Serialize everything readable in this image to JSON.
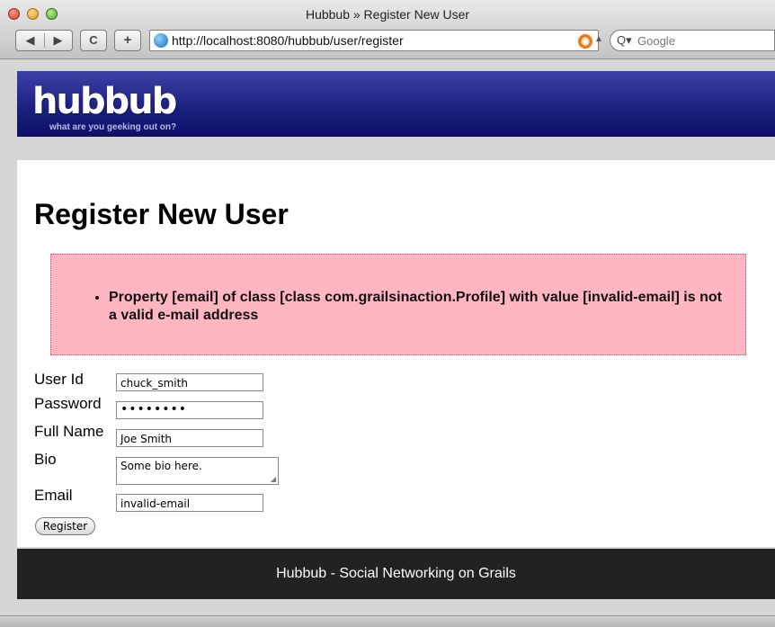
{
  "browser": {
    "window_title": "Hubbub » Register New User",
    "url": "http://localhost:8080/hubbub/user/register",
    "search_placeholder": "Google",
    "back_glyph": "◀",
    "forward_glyph": "▶",
    "reload_glyph": "C",
    "add_glyph": "+"
  },
  "header": {
    "logo": "hubbub",
    "tagline": "what are you geeking out on?"
  },
  "main": {
    "title": "Register New User",
    "errors": [
      "Property [email] of class [class com.grailsinaction.Profile] with value [invalid-email] is not a valid e-mail address"
    ],
    "form": {
      "user_id": {
        "label": "User Id",
        "value": "chuck_smith"
      },
      "password": {
        "label": "Password",
        "value": "••••••••"
      },
      "full_name": {
        "label": "Full Name",
        "value": "Joe Smith"
      },
      "bio": {
        "label": "Bio",
        "value": "Some bio here."
      },
      "email": {
        "label": "Email",
        "value": "invalid-email"
      },
      "submit_label": "Register"
    }
  },
  "footer": {
    "text": "Hubbub - Social Networking on Grails"
  },
  "colors": {
    "header_blue": "#1a1f7c",
    "error_pink": "#ffb6c1",
    "footer_dark": "#222222"
  },
  "icons": [
    "globe-icon",
    "rss-icon",
    "search-icon",
    "reload-icon",
    "back-icon",
    "forward-icon"
  ]
}
